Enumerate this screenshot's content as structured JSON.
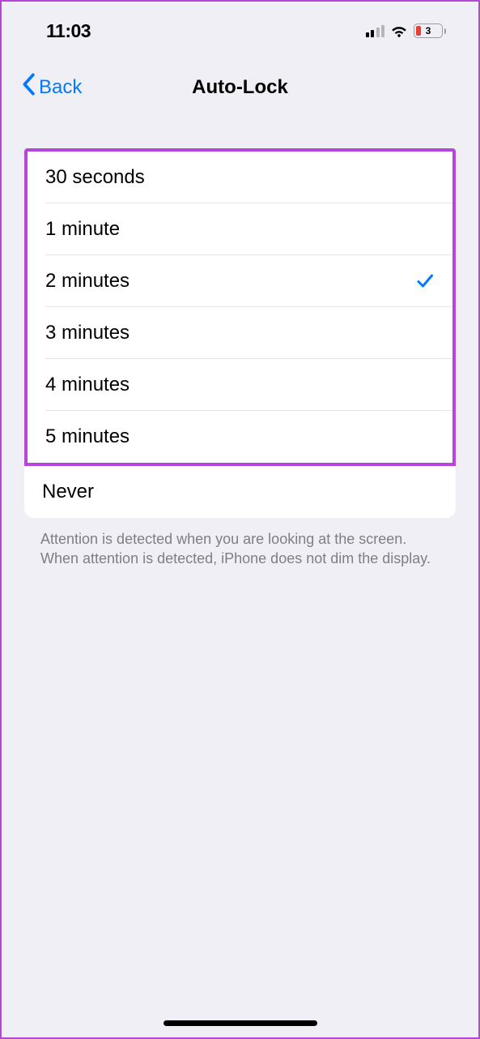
{
  "status": {
    "time": "11:03",
    "battery_level": "3"
  },
  "nav": {
    "back_label": "Back",
    "title": "Auto-Lock"
  },
  "options": [
    {
      "label": "30 seconds",
      "selected": false
    },
    {
      "label": "1 minute",
      "selected": false
    },
    {
      "label": "2 minutes",
      "selected": true
    },
    {
      "label": "3 minutes",
      "selected": false
    },
    {
      "label": "4 minutes",
      "selected": false
    },
    {
      "label": "5 minutes",
      "selected": false
    },
    {
      "label": "Never",
      "selected": false
    }
  ],
  "footer": {
    "note": "Attention is detected when you are looking at the screen. When attention is detected, iPhone does not dim the display."
  }
}
